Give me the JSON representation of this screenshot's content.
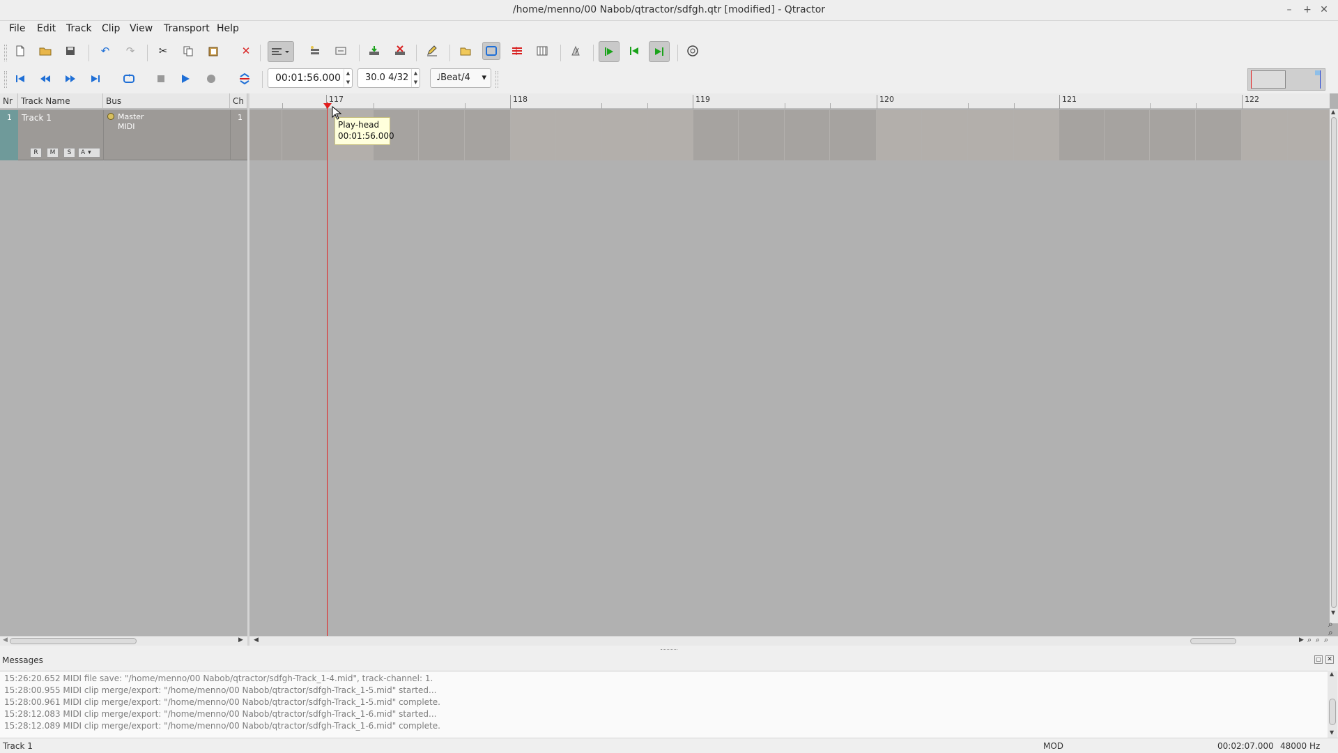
{
  "window": {
    "title": "/home/menno/00 Nabob/qtractor/sdfgh.qtr [modified] - Qtractor",
    "controls": {
      "minimize": "–",
      "maximize": "+",
      "close": "✕"
    }
  },
  "menubar": {
    "items": [
      "File",
      "Edit",
      "Track",
      "Clip",
      "View",
      "Transport",
      "Help"
    ]
  },
  "toolbar": {
    "time_value": "00:01:56.000",
    "tempo_value": "30.0 4/32",
    "snap_value": "Beat/4",
    "snap_prefix": "♩",
    "combo_arrow": "▾",
    "spin_up": "▲",
    "spin_down": "▼"
  },
  "tracklist": {
    "headers": {
      "nr": "Nr",
      "name": "Track Name",
      "bus": "Bus",
      "ch": "Ch"
    },
    "tracks": [
      {
        "nr": "1",
        "name": "Track 1",
        "bus": "Master",
        "bus_type": "MIDI",
        "ch": "1",
        "buttons": {
          "rec": "R",
          "mute": "M",
          "solo": "S",
          "auto": "A",
          "auto_arrow": "▾"
        }
      }
    ]
  },
  "ruler": {
    "bars": [
      "117",
      "118",
      "119",
      "120",
      "121",
      "122"
    ]
  },
  "tooltip": {
    "title": "Play-head",
    "time": "00:01:56.000"
  },
  "scroll_arrows": {
    "left": "◀",
    "right": "▶",
    "up": "▲",
    "down": "▼"
  },
  "zoom_icons": {
    "zoom": "⌕"
  },
  "messages": {
    "title": "Messages",
    "lines": [
      "15:26:20.652 MIDI file save: \"/home/menno/00 Nabob/qtractor/sdfgh-Track_1-4.mid\", track-channel: 1.",
      "15:28:00.955 MIDI clip merge/export: \"/home/menno/00 Nabob/qtractor/sdfgh-Track_1-5.mid\" started...",
      "15:28:00.961 MIDI clip merge/export: \"/home/menno/00 Nabob/qtractor/sdfgh-Track_1-5.mid\" complete.",
      "15:28:12.083 MIDI clip merge/export: \"/home/menno/00 Nabob/qtractor/sdfgh-Track_1-6.mid\" started...",
      "15:28:12.089 MIDI clip merge/export: \"/home/menno/00 Nabob/qtractor/sdfgh-Track_1-6.mid\" complete."
    ]
  },
  "statusbar": {
    "track": "Track 1",
    "mod": "MOD",
    "session_length": "00:02:07.000",
    "sample_rate": "48000 Hz"
  },
  "colors": {
    "playhead": "#e21c1c",
    "play_green": "#1aa31a",
    "transport_blue": "#1f6fd6",
    "delete_red": "#d81e1e"
  }
}
